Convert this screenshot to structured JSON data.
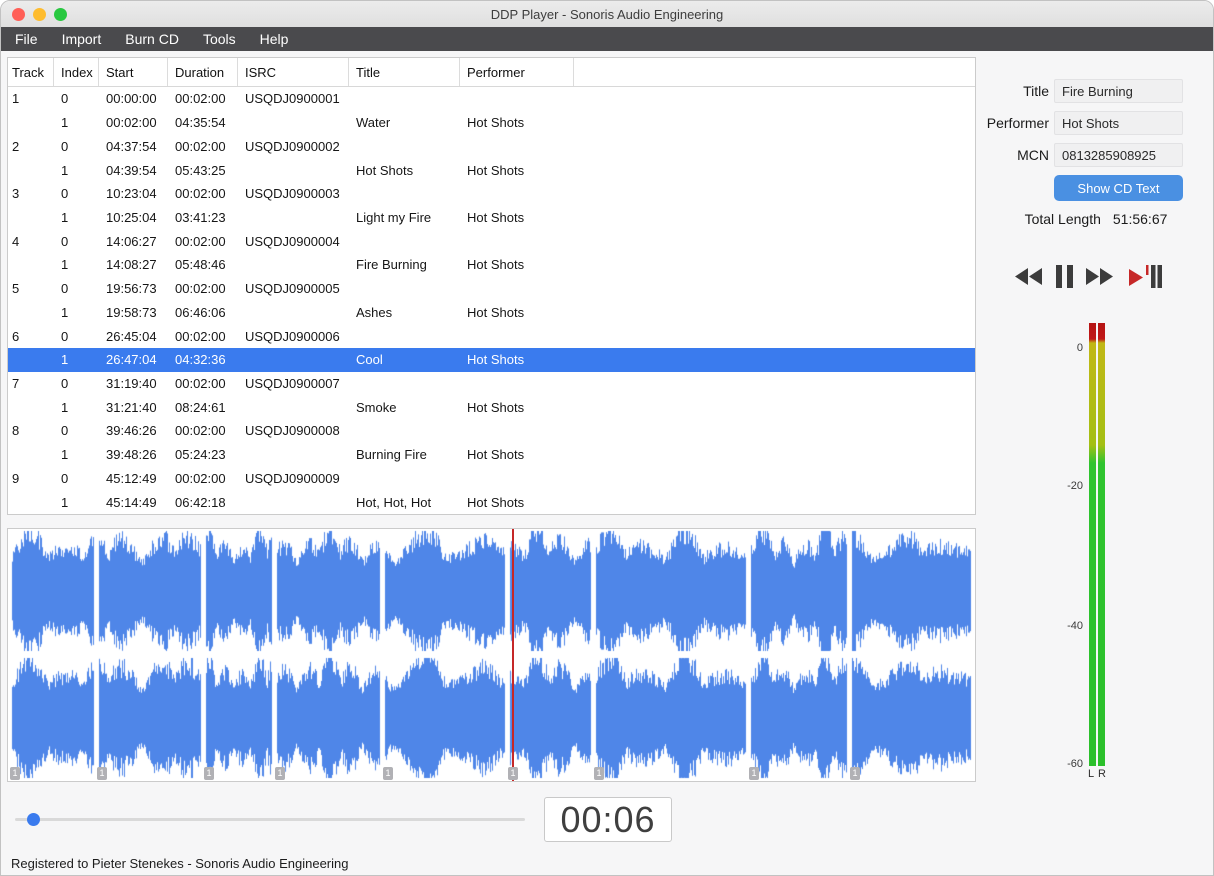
{
  "window": {
    "title": "DDP Player - Sonoris Audio Engineering"
  },
  "menu": {
    "items": [
      "File",
      "Import",
      "Burn CD",
      "Tools",
      "Help"
    ]
  },
  "table": {
    "columns": [
      "Track",
      "Index",
      "Start",
      "Duration",
      "ISRC",
      "Title",
      "Performer"
    ],
    "rows": [
      {
        "track": "1",
        "index": "0",
        "start": "00:00:00",
        "duration": "00:02:00",
        "isrc": "USQDJ0900001",
        "title": "",
        "performer": "",
        "selected": false
      },
      {
        "track": "",
        "index": "1",
        "start": "00:02:00",
        "duration": "04:35:54",
        "isrc": "",
        "title": "Water",
        "performer": "Hot Shots",
        "selected": false
      },
      {
        "track": "2",
        "index": "0",
        "start": "04:37:54",
        "duration": "00:02:00",
        "isrc": "USQDJ0900002",
        "title": "",
        "performer": "",
        "selected": false
      },
      {
        "track": "",
        "index": "1",
        "start": "04:39:54",
        "duration": "05:43:25",
        "isrc": "",
        "title": "Hot Shots",
        "performer": "Hot Shots",
        "selected": false
      },
      {
        "track": "3",
        "index": "0",
        "start": "10:23:04",
        "duration": "00:02:00",
        "isrc": "USQDJ0900003",
        "title": "",
        "performer": "",
        "selected": false
      },
      {
        "track": "",
        "index": "1",
        "start": "10:25:04",
        "duration": "03:41:23",
        "isrc": "",
        "title": "Light my Fire",
        "performer": "Hot Shots",
        "selected": false
      },
      {
        "track": "4",
        "index": "0",
        "start": "14:06:27",
        "duration": "00:02:00",
        "isrc": "USQDJ0900004",
        "title": "",
        "performer": "",
        "selected": false
      },
      {
        "track": "",
        "index": "1",
        "start": "14:08:27",
        "duration": "05:48:46",
        "isrc": "",
        "title": "Fire Burning",
        "performer": "Hot Shots",
        "selected": false
      },
      {
        "track": "5",
        "index": "0",
        "start": "19:56:73",
        "duration": "00:02:00",
        "isrc": "USQDJ0900005",
        "title": "",
        "performer": "",
        "selected": false
      },
      {
        "track": "",
        "index": "1",
        "start": "19:58:73",
        "duration": "06:46:06",
        "isrc": "",
        "title": "Ashes",
        "performer": "Hot Shots",
        "selected": false
      },
      {
        "track": "6",
        "index": "0",
        "start": "26:45:04",
        "duration": "00:02:00",
        "isrc": "USQDJ0900006",
        "title": "",
        "performer": "",
        "selected": false
      },
      {
        "track": "",
        "index": "1",
        "start": "26:47:04",
        "duration": "04:32:36",
        "isrc": "",
        "title": "Cool",
        "performer": "Hot Shots",
        "selected": true
      },
      {
        "track": "7",
        "index": "0",
        "start": "31:19:40",
        "duration": "00:02:00",
        "isrc": "USQDJ0900007",
        "title": "",
        "performer": "",
        "selected": false
      },
      {
        "track": "",
        "index": "1",
        "start": "31:21:40",
        "duration": "08:24:61",
        "isrc": "",
        "title": "Smoke",
        "performer": "Hot Shots",
        "selected": false
      },
      {
        "track": "8",
        "index": "0",
        "start": "39:46:26",
        "duration": "00:02:00",
        "isrc": "USQDJ0900008",
        "title": "",
        "performer": "",
        "selected": false
      },
      {
        "track": "",
        "index": "1",
        "start": "39:48:26",
        "duration": "05:24:23",
        "isrc": "",
        "title": "Burning Fire",
        "performer": "Hot Shots",
        "selected": false
      },
      {
        "track": "9",
        "index": "0",
        "start": "45:12:49",
        "duration": "00:02:00",
        "isrc": "USQDJ0900009",
        "title": "",
        "performer": "",
        "selected": false
      },
      {
        "track": "",
        "index": "1",
        "start": "45:14:49",
        "duration": "06:42:18",
        "isrc": "",
        "title": "Hot, Hot, Hot",
        "performer": "Hot Shots",
        "selected": false
      }
    ]
  },
  "side_panel": {
    "fields": [
      {
        "label": "Title",
        "value": "Fire Burning"
      },
      {
        "label": "Performer",
        "value": "Hot Shots"
      },
      {
        "label": "MCN",
        "value": "0813285908925"
      }
    ],
    "show_cd_text_button": "Show CD Text",
    "total_length_label": "Total Length",
    "total_length_value": "51:56:67"
  },
  "transport": {
    "buttons": [
      "rewind",
      "pause",
      "fast-forward",
      "play-to-marker"
    ]
  },
  "meters": {
    "scale_labels": [
      "0",
      "-20",
      "-40",
      "-60"
    ],
    "channel_labels": [
      "L",
      "R"
    ]
  },
  "waveform": {
    "segments": [
      {
        "track": 1,
        "title": "Water",
        "duration_s": 275.7
      },
      {
        "track": 2,
        "title": "Hot Shots",
        "duration_s": 343.3
      },
      {
        "track": 3,
        "title": "Light my Fire",
        "duration_s": 221.3
      },
      {
        "track": 4,
        "title": "Fire Burning",
        "duration_s": 348.6
      },
      {
        "track": 5,
        "title": "Ashes",
        "duration_s": 406.1
      },
      {
        "track": 6,
        "title": "Cool",
        "duration_s": 272.5
      },
      {
        "track": 7,
        "title": "Smoke",
        "duration_s": 504.8
      },
      {
        "track": 8,
        "title": "Burning Fire",
        "duration_s": 324.3
      },
      {
        "track": 9,
        "title": "Hot, Hot, Hot",
        "duration_s": 402.2
      }
    ],
    "marker_label": "1",
    "playhead_segment": 6,
    "playhead_offset_s": 6
  },
  "time_display": {
    "value": "00:06"
  },
  "slider": {
    "value_fraction": 0.035
  },
  "status_bar": {
    "text": "Registered to Pieter Stenekes - Sonoris Audio Engineering"
  },
  "colors": {
    "selection": "#3a7bee",
    "accent_button": "#4a90e2",
    "waveform": "#4f86e8",
    "playhead": "#c62828",
    "meter_red": "#c11818",
    "meter_yellow": "#c1b816",
    "meter_green": "#2bc02b",
    "traffic_red": "#ff5f57",
    "traffic_yellow": "#febc2e",
    "traffic_green": "#28c840"
  }
}
